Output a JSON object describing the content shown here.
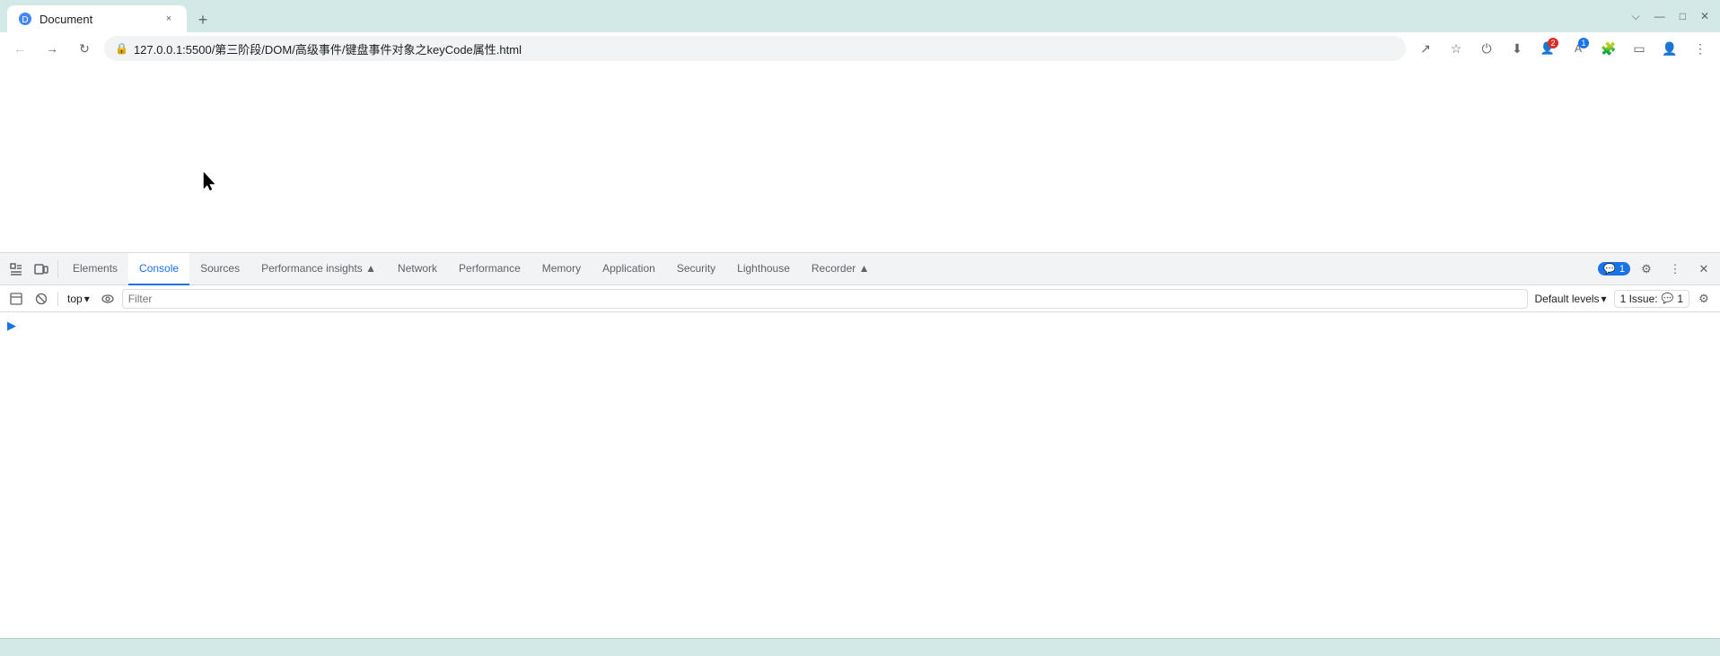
{
  "browser": {
    "title": "Document",
    "url": "127.0.0.1:5500/第三阶段/DOM/高级事件/键盘事件对象之keyCode属性.html",
    "tab_close": "×",
    "new_tab": "+",
    "back_disabled": true,
    "forward_disabled": true
  },
  "window_controls": {
    "minimize": "—",
    "maximize": "□",
    "close": "×",
    "profile": "▼"
  },
  "devtools": {
    "tabs": [
      {
        "id": "elements",
        "label": "Elements"
      },
      {
        "id": "console",
        "label": "Console",
        "active": true
      },
      {
        "id": "sources",
        "label": "Sources"
      },
      {
        "id": "performance-insights",
        "label": "Performance insights ▲"
      },
      {
        "id": "network",
        "label": "Network"
      },
      {
        "id": "performance",
        "label": "Performance"
      },
      {
        "id": "memory",
        "label": "Memory"
      },
      {
        "id": "application",
        "label": "Application"
      },
      {
        "id": "security",
        "label": "Security"
      },
      {
        "id": "lighthouse",
        "label": "Lighthouse"
      },
      {
        "id": "recorder",
        "label": "Recorder ▲"
      }
    ],
    "issues_count": "1",
    "issues_label": "1 Issue:",
    "issues_num": "1"
  },
  "console_toolbar": {
    "top_label": "top",
    "filter_placeholder": "Filter",
    "default_levels_label": "Default levels",
    "issue_label": "1 Issue:",
    "issue_count": "1"
  },
  "icons": {
    "inspect": "⬚",
    "device": "▭",
    "clear": "🚫",
    "eye": "👁",
    "chevron": "▾",
    "gear": "⚙",
    "more": "⋮",
    "close": "✕",
    "back": "←",
    "forward": "→",
    "refresh": "↻",
    "share": "↗",
    "bookmark": "☆",
    "cast": "⊡",
    "puzzle": "🧩",
    "person": "👤",
    "menu": "≡",
    "down_arrow": "▾",
    "console_icon": "⊡",
    "arrow_right": "▶"
  }
}
